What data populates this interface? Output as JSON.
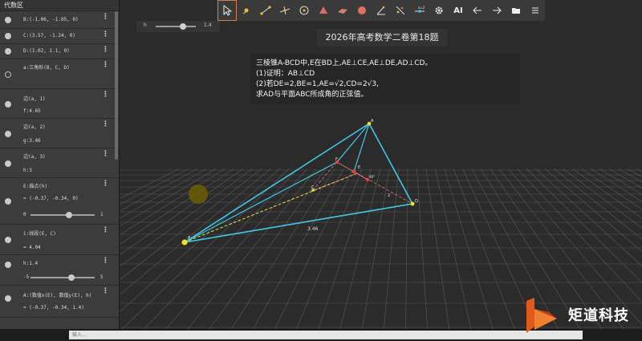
{
  "sidebar": {
    "title": "代数区",
    "items": [
      {
        "text": "B:(-1.06, -1.05, 0)"
      },
      {
        "text": "C:(3.57, -1.24, 0)"
      },
      {
        "text": "D:(1.02, 1.1, 0)"
      },
      {
        "text": "a:三角形(B, C, D)"
      },
      {
        "line1": "边(a, 1)",
        "line2": "f:4.65"
      },
      {
        "line1": "边(a, 2)",
        "line2": "g:3.46"
      },
      {
        "line1": "边(a, 3)",
        "line2": "h:3"
      },
      {
        "line1": "E:描点(h)",
        "line2": " = (-0.37, -0.34, 0)",
        "slider_min": "0",
        "slider_max": "1",
        "slider_value": 0.6
      },
      {
        "line1": "i:线段(E, C)",
        "line2": " = 4.04"
      },
      {
        "line1": "h:1.4",
        "slider_min": "-5",
        "slider_max": "5",
        "slider_value": 0.64
      },
      {
        "line1": "A:(数值x(E), 数值y(E), h)",
        "line2": " = (-0.37, -0.34, 1.4)"
      }
    ]
  },
  "toolbar": {
    "tools": [
      "move-tool",
      "point-tool",
      "segment-tool",
      "perpendicular-line-tool",
      "circle-tool",
      "pyramid-tool",
      "plane-tool",
      "sphere-tool",
      "angle-tool",
      "reflect-tool",
      "slider-tool",
      "settings-tool",
      "ai-tool",
      "undo-tool",
      "redo-tool",
      "folder-tool",
      "menu-tool"
    ],
    "ai_label": "AI"
  },
  "h_slider": {
    "label": "h",
    "value": "1.4"
  },
  "canvas": {
    "title": "2026年高考数学二卷第18题",
    "problem_lines": [
      "三棱锥A-BCD中,E在BD上,AE⊥CE,AE⊥DE,AD⊥CD。",
      "(1)证明：AB⊥CD",
      "(2)若DE=2,BE=1,AE=√2,CD=2√3,",
      "求AD与平面ABC所成角的正弦值。"
    ],
    "labels": {
      "A": "A",
      "B": "B",
      "C": "C",
      "D": "D",
      "E": "E",
      "F": "F",
      "side_len": "3.46",
      "len_small": "2",
      "angle_mark": "90°"
    }
  },
  "input": {
    "placeholder": "输入..."
  },
  "brand": {
    "name": "矩道科技",
    "accent": "#e05a1e"
  },
  "colors": {
    "edges": "#3ec8e6",
    "dashed": "#e8e040",
    "point": "#f0e020",
    "grid": "#5a5a5a"
  }
}
